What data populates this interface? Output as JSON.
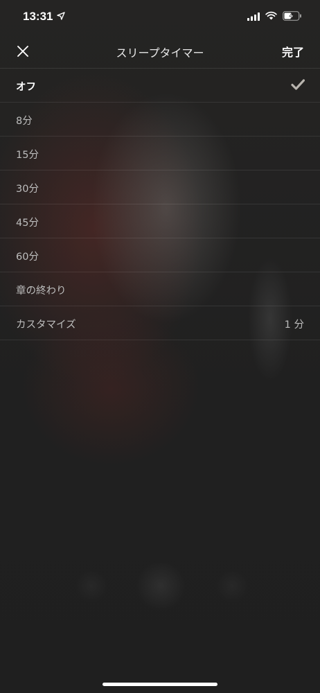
{
  "status_bar": {
    "time": "13:31",
    "icons": [
      "location-arrow-icon",
      "cellular-signal-icon",
      "wifi-icon",
      "battery-charging-icon"
    ]
  },
  "nav": {
    "title": "スリープタイマー",
    "done_label": "完了",
    "close_icon": "close-icon"
  },
  "options": [
    {
      "label": "オフ",
      "value": "",
      "selected": true
    },
    {
      "label": "8分",
      "value": "",
      "selected": false
    },
    {
      "label": "15分",
      "value": "",
      "selected": false
    },
    {
      "label": "30分",
      "value": "",
      "selected": false
    },
    {
      "label": "45分",
      "value": "",
      "selected": false
    },
    {
      "label": "60分",
      "value": "",
      "selected": false
    },
    {
      "label": "章の終わり",
      "value": "",
      "selected": false
    },
    {
      "label": "カスタマイズ",
      "value": "1 分",
      "selected": false
    }
  ],
  "colors": {
    "background": "#1f1f1f",
    "text_primary": "#ffffff",
    "text_secondary": "#bdbdbd",
    "check": "#b8b4ae"
  }
}
